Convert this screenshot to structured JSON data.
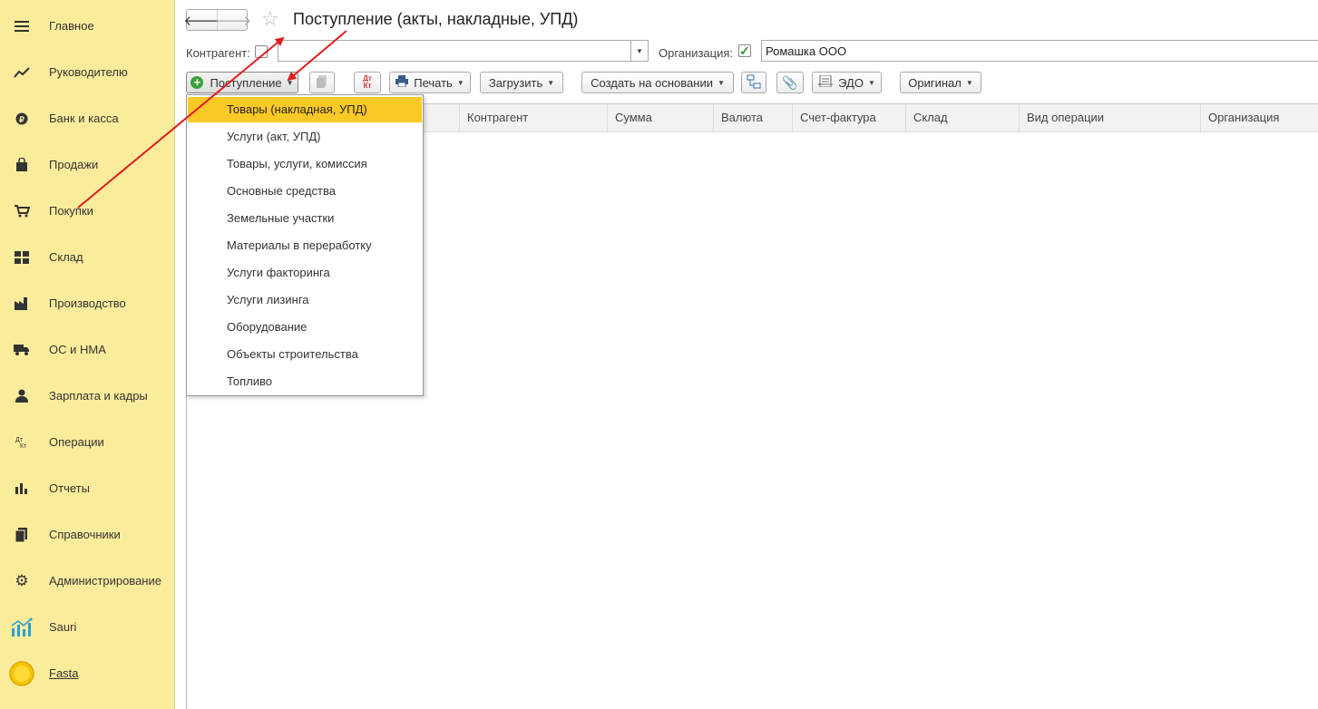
{
  "sidebar": {
    "items": [
      {
        "label": "Главное",
        "icon": "hamburger-icon"
      },
      {
        "label": "Руководителю",
        "icon": "trend-icon"
      },
      {
        "label": "Банк и касса",
        "icon": "coin-icon"
      },
      {
        "label": "Продажи",
        "icon": "bag-icon"
      },
      {
        "label": "Покупки",
        "icon": "cart-icon"
      },
      {
        "label": "Склад",
        "icon": "warehouse-icon"
      },
      {
        "label": "Производство",
        "icon": "factory-icon"
      },
      {
        "label": "ОС и НМА",
        "icon": "truck-icon"
      },
      {
        "label": "Зарплата и кадры",
        "icon": "person-icon"
      },
      {
        "label": "Операции",
        "icon": "dt-kt-icon"
      },
      {
        "label": "Отчеты",
        "icon": "bar-chart-icon"
      },
      {
        "label": "Справочники",
        "icon": "book-icon"
      },
      {
        "label": "Администрирование",
        "icon": "gear-icon"
      },
      {
        "label": "Sauri",
        "icon": "sauri-chart-icon"
      },
      {
        "label": "Fasta",
        "icon": "fasta-circle-icon"
      }
    ]
  },
  "header": {
    "title": "Поступление (акты, накладные, УПД)"
  },
  "filters": {
    "counterparty_label": "Контрагент:",
    "counterparty_value": "",
    "organization_label": "Организация:",
    "organization_value": "Ромашка ООО"
  },
  "toolbar": {
    "receipt_label": "Поступление",
    "print_label": "Печать",
    "load_label": "Загрузить",
    "create_based_label": "Создать на основании",
    "edo_label": "ЭДО",
    "original_label": "Оригинал"
  },
  "table": {
    "columns": [
      "Контрагент",
      "Сумма",
      "Валюта",
      "Счет-фактура",
      "Склад",
      "Вид операции",
      "Организация"
    ]
  },
  "menu": {
    "items": [
      "Товары (накладная, УПД)",
      "Услуги (акт, УПД)",
      "Товары, услуги, комиссия",
      "Основные средства",
      "Земельные участки",
      "Материалы в переработку",
      "Услуги факторинга",
      "Услуги лизинга",
      "Оборудование",
      "Объекты строительства",
      "Топливо"
    ],
    "highlighted": "Товары (накладная, УПД)"
  },
  "colors": {
    "sidebar_bg": "#fbec9c",
    "highlight": "#fbc925",
    "annotation_arrow": "#e01b1b"
  }
}
